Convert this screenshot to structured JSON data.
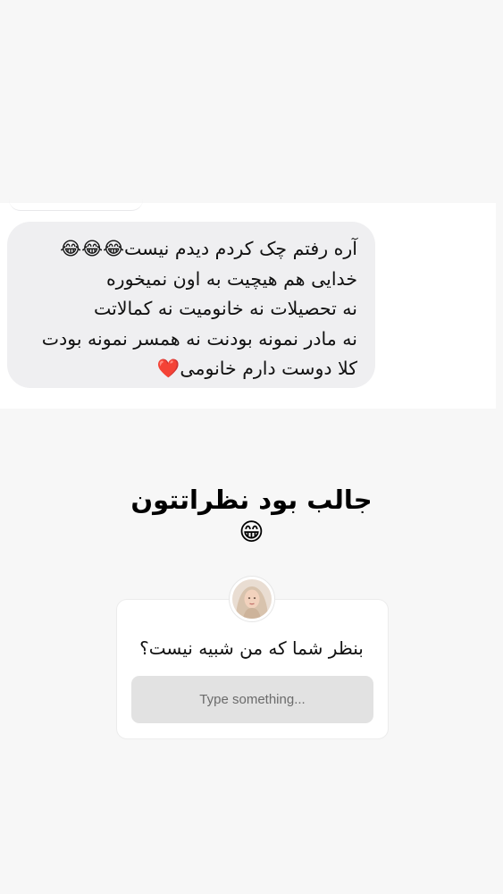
{
  "dm_screenshot": {
    "lines": [
      "آره رفتم چک کردم دیدم نیست😂😂😂",
      "خدایی هم هیچیت به اون نمیخوره",
      "نه تحصیلات نه خانومیت نه کمالاتت",
      "نه مادر نمونه بودنت نه همسر نمونه بودت",
      "کلا دوست دارم خانومی❤️"
    ],
    "bubble_color": "#efeff1"
  },
  "story": {
    "title": "جالب بود نظراتتون",
    "title_emoji": "😁",
    "background_color": "#f7f7f7"
  },
  "question_sticker": {
    "question": "بنظر شما که من شبیه نیست؟",
    "placeholder": "Type something...",
    "avatar_icon": "user-avatar"
  }
}
